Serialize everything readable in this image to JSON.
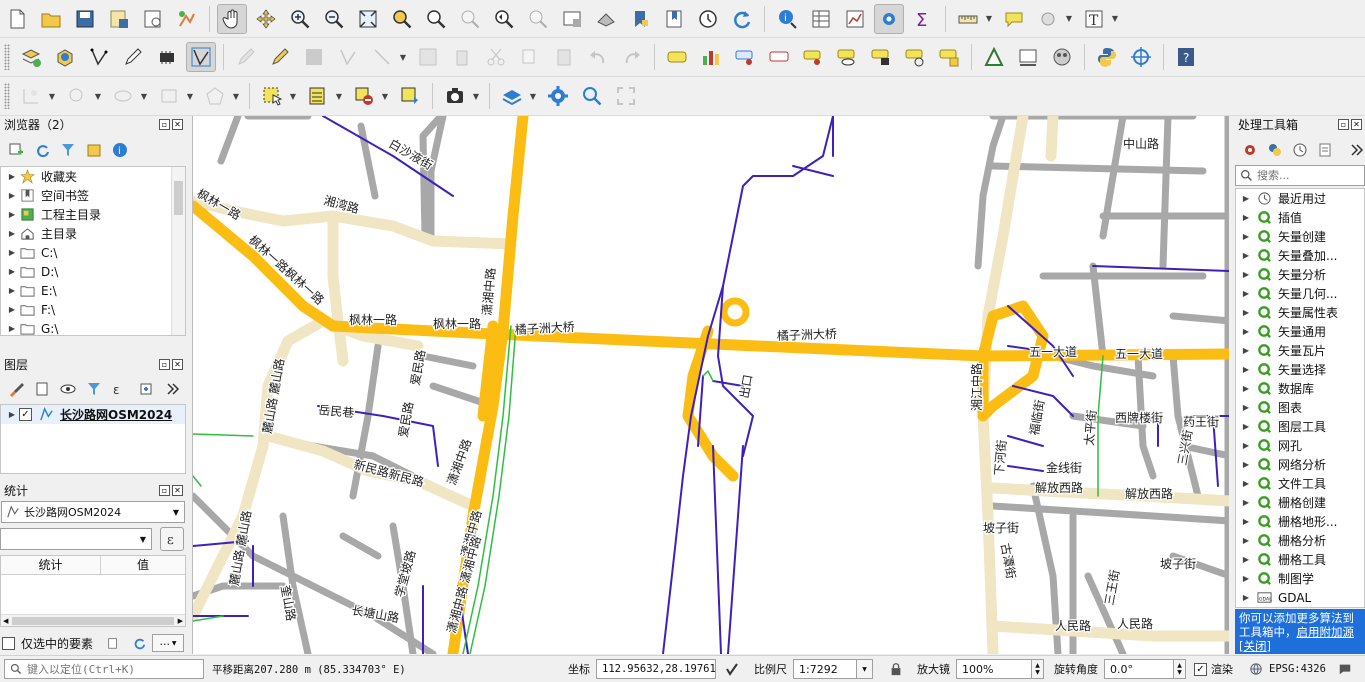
{
  "toolbar_rows": {
    "row1": [
      "new-project",
      "open-project",
      "save-project",
      "save-as",
      "print-layout",
      "style-manager",
      "pan-map",
      "pan-to-selection",
      "zoom-in",
      "zoom-out",
      "zoom-full",
      "zoom-layer",
      "zoom-selection",
      "zoom-native",
      "zoom-last",
      "zoom-next",
      "new-map-view",
      "new-3d-view",
      "new-bookmark",
      "show-bookmarks",
      "temporal",
      "refresh",
      "identify",
      "attribute-table",
      "statistics-summary",
      "options",
      "field-calculator",
      "measure",
      "annotation",
      "select-location",
      "text-annotation"
    ],
    "row2": [
      "add-layer",
      "open-dataset",
      "digitize",
      "toggle-editing",
      "save-edits",
      "current-edits"
    ],
    "row3": [
      "select-feature",
      "deselect"
    ]
  },
  "browser": {
    "title": "浏览器（2）",
    "items": [
      {
        "label": "收藏夹",
        "icon": "star-icon"
      },
      {
        "label": "空间书签",
        "icon": "bookmark-icon"
      },
      {
        "label": "工程主目录",
        "icon": "project-home-icon"
      },
      {
        "label": "主目录",
        "icon": "home-icon"
      },
      {
        "label": "C:\\",
        "icon": "folder-icon"
      },
      {
        "label": "D:\\",
        "icon": "folder-icon"
      },
      {
        "label": "E:\\",
        "icon": "folder-icon"
      },
      {
        "label": "F:\\",
        "icon": "folder-icon"
      },
      {
        "label": "G:\\",
        "icon": "folder-icon"
      }
    ]
  },
  "layers": {
    "title": "图层",
    "items": [
      {
        "label": "长沙路网OSM2024",
        "checked": true
      }
    ]
  },
  "stats": {
    "title": "统计",
    "layer": "长沙路网OSM2024",
    "field_value": "",
    "col_stat": "统计",
    "col_value": "值",
    "selected_only_label": "仅选中的要素",
    "more_label": "..."
  },
  "toolbox": {
    "title": "处理工具箱",
    "search_placeholder": "搜索...",
    "items": [
      {
        "label": "最近用过",
        "icon": "clock-icon"
      },
      {
        "label": "插值",
        "icon": "qgis-icon"
      },
      {
        "label": "矢量创建",
        "icon": "qgis-icon"
      },
      {
        "label": "矢量叠加...",
        "icon": "qgis-icon"
      },
      {
        "label": "矢量分析",
        "icon": "qgis-icon"
      },
      {
        "label": "矢量几何...",
        "icon": "qgis-icon"
      },
      {
        "label": "矢量属性表",
        "icon": "qgis-icon"
      },
      {
        "label": "矢量通用",
        "icon": "qgis-icon"
      },
      {
        "label": "矢量瓦片",
        "icon": "qgis-icon"
      },
      {
        "label": "矢量选择",
        "icon": "qgis-icon"
      },
      {
        "label": "数据库",
        "icon": "qgis-icon"
      },
      {
        "label": "图表",
        "icon": "qgis-icon"
      },
      {
        "label": "图层工具",
        "icon": "qgis-icon"
      },
      {
        "label": "网孔",
        "icon": "qgis-icon"
      },
      {
        "label": "网络分析",
        "icon": "qgis-icon"
      },
      {
        "label": "文件工具",
        "icon": "qgis-icon"
      },
      {
        "label": "栅格创建",
        "icon": "qgis-icon"
      },
      {
        "label": "栅格地形...",
        "icon": "qgis-icon"
      },
      {
        "label": "栅格分析",
        "icon": "qgis-icon"
      },
      {
        "label": "栅格工具",
        "icon": "qgis-icon"
      },
      {
        "label": "制图学",
        "icon": "qgis-icon"
      },
      {
        "label": "GDAL",
        "icon": "gdal-icon"
      }
    ],
    "notice_text": "你可以添加更多算法到工具箱中，",
    "notice_link1": "启用附加源",
    "notice_link2": "[关闭]"
  },
  "map_labels": [
    {
      "text": "白沙液街"
    },
    {
      "text": "枫林一路"
    },
    {
      "text": "枫林一路枫林一路"
    },
    {
      "text": "湘湾路"
    },
    {
      "text": "潇湘中路"
    },
    {
      "text": "枫林一路"
    },
    {
      "text": "枫林一路"
    },
    {
      "text": "橘子洲大桥"
    },
    {
      "text": "橘子洲大桥"
    },
    {
      "text": "麓山路 麓山路"
    },
    {
      "text": "岳民巷"
    },
    {
      "text": "爱民路"
    },
    {
      "text": "爱民路"
    },
    {
      "text": "新民路新民路"
    },
    {
      "text": "潇湘中路"
    },
    {
      "text": "出口"
    },
    {
      "text": "麓山路 麓山路"
    },
    {
      "text": "奎山路"
    },
    {
      "text": "学堂坡路"
    },
    {
      "text": "潇湘中路"
    },
    {
      "text": "潇湘中路 潇湘中路"
    },
    {
      "text": "长塘山路"
    },
    {
      "text": "中山路"
    },
    {
      "text": "五一大道"
    },
    {
      "text": "五一大道"
    },
    {
      "text": "湘江中路"
    },
    {
      "text": "福临街"
    },
    {
      "text": "太平街"
    },
    {
      "text": "西牌楼街"
    },
    {
      "text": "药王街"
    },
    {
      "text": "下河街"
    },
    {
      "text": "金线街"
    },
    {
      "text": "解放西路"
    },
    {
      "text": "解放西路"
    },
    {
      "text": "坡子街"
    },
    {
      "text": "坡子街"
    },
    {
      "text": "古潭街"
    },
    {
      "text": "三王街"
    },
    {
      "text": "人民路"
    },
    {
      "text": "人民路"
    },
    {
      "text": "三兴街"
    }
  ],
  "status": {
    "locator_placeholder": "键入以定位(Ctrl+K)",
    "message": "平移距离207.280 m (85.334703° E)",
    "coord_label": "坐标",
    "coord_value": "112.95632,28.19761",
    "scale_label": "比例尺",
    "scale_value": "1:7292",
    "magnifier_label": "放大镜",
    "magnifier_value": "100%",
    "rotation_label": "旋转角度",
    "rotation_value": "0.0°",
    "render_label": "渲染",
    "crs_label": "EPSG:4326"
  }
}
